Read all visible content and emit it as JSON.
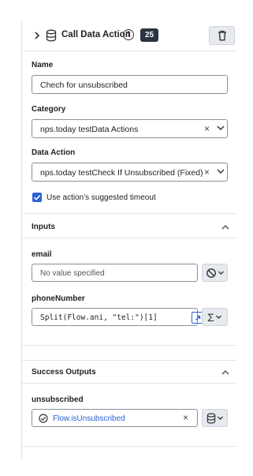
{
  "header": {
    "title": "Call Data Action",
    "help_glyph": "?",
    "count": "25"
  },
  "name": {
    "label": "Name",
    "value": "Chech for unsubscribed"
  },
  "category": {
    "label": "Category",
    "value": "nps.today testData Actions"
  },
  "data_action": {
    "label": "Data Action",
    "value": "nps.today testCheck If Unsubscribed (Fixed)"
  },
  "timeout": {
    "label": "Use action's suggested timeout",
    "checked": true
  },
  "inputs": {
    "title": "Inputs",
    "email": {
      "label": "email",
      "placeholder": "No value specified"
    },
    "phone": {
      "label": "phoneNumber",
      "value": "Split(Flow.ani, \"tel:\")[1]"
    }
  },
  "outputs": {
    "title": "Success Outputs",
    "unsubscribed": {
      "label": "unsubscribed",
      "value": "Flow.isUnsubscribed"
    }
  },
  "glyphs": {
    "clear": "×",
    "sigma": "Σ"
  },
  "colors": {
    "accent": "#2a62d6",
    "badge_bg": "#2c3341",
    "button_bg": "#e6e9ee"
  }
}
